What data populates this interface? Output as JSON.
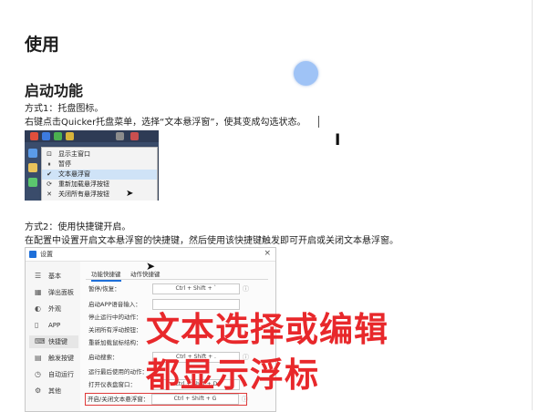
{
  "heading": "使用",
  "section_heading": "启动功能",
  "method1_title": "方式1：托盘图标。",
  "method1_desc": "右键点击Quicker托盘菜单，选择“文本悬浮窗”，使其变成勾选状态。",
  "tray_menu": {
    "items": [
      {
        "icon": "⊡",
        "label": "显示主窗口"
      },
      {
        "icon": "⏸",
        "label": "暂停"
      },
      {
        "icon": "✔",
        "label": "文本悬浮窗"
      },
      {
        "icon": "⟳",
        "label": "重新加载悬浮按钮"
      },
      {
        "icon": "✕",
        "label": "关闭所有悬浮按钮"
      }
    ]
  },
  "method2_title": "方式2：使用快捷键开启。",
  "method2_desc": "在配置中设置开启文本悬浮窗的快捷键，然后使用该快捷键触发即可开启或关闭文本悬浮窗。",
  "settings": {
    "title": "设置",
    "close": "×",
    "nav": [
      {
        "icon": "☰",
        "label": "基本"
      },
      {
        "icon": "▦",
        "label": "弹出面板"
      },
      {
        "icon": "◐",
        "label": "外观"
      },
      {
        "icon": "▯",
        "label": "APP"
      },
      {
        "icon": "⌨",
        "label": "快捷键"
      },
      {
        "icon": "▤",
        "label": "触发按键"
      },
      {
        "icon": "◷",
        "label": "自动运行"
      },
      {
        "icon": "⚙",
        "label": "其他"
      }
    ],
    "tabs": [
      "功能快捷键",
      "动作快捷键"
    ],
    "rows": [
      {
        "label": "暂停/恢复：",
        "value": "Ctrl + Shift + `",
        "info": "ⓘ"
      },
      {
        "label": "启动APP语音输入：",
        "value": "",
        "info": ""
      },
      {
        "label": "停止运行中的动作：",
        "value": "",
        "info": ""
      },
      {
        "label": "关闭所有浮动按钮：",
        "value": "",
        "info": ""
      },
      {
        "label": "重新加载鼠标结构：",
        "value": "",
        "info": ""
      },
      {
        "label": "启动搜索：",
        "value": "Ctrl + Shift + .",
        "info": "ⓘ"
      },
      {
        "label": "运行最后使用的动作：",
        "value": "",
        "info": ""
      },
      {
        "label": "打开仪表盘窗口：",
        "value": "Ctrl + Shift + D",
        "info": ""
      },
      {
        "label": "开启/关闭文本悬浮窗：",
        "value": "Ctrl + Shift + G",
        "info": "ⓘ"
      }
    ]
  },
  "overlay_line1": "文本选择或编辑",
  "overlay_line2": "都显示浮标",
  "colors": {
    "overlay": "#e8282b",
    "accent": "#1e6fd9",
    "blob": "#9fc3f6"
  }
}
